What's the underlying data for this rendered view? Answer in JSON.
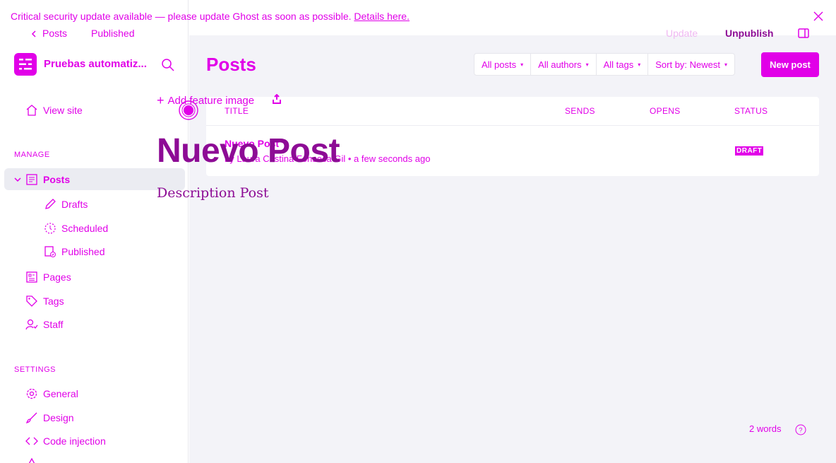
{
  "banner": {
    "text": "Critical security update available — please update Ghost as soon as possible.",
    "link": "Details here."
  },
  "editor_header": {
    "back_label": "Posts",
    "status": "Published",
    "update_label": "Update",
    "unpublish_label": "Unpublish"
  },
  "sidebar": {
    "brand": "Pruebas automatiz...",
    "view_site": "View site",
    "manage_heading": "MANAGE",
    "items": [
      {
        "label": "Posts",
        "icon": "posts-icon"
      },
      {
        "label": "Drafts",
        "icon": "pencil-icon"
      },
      {
        "label": "Scheduled",
        "icon": "clock-icon"
      },
      {
        "label": "Published",
        "icon": "published-icon"
      },
      {
        "label": "Pages",
        "icon": "pages-icon"
      },
      {
        "label": "Tags",
        "icon": "tag-icon"
      },
      {
        "label": "Staff",
        "icon": "staff-icon"
      }
    ],
    "settings_heading": "SETTINGS",
    "settings": [
      {
        "label": "General",
        "icon": "gear-icon"
      },
      {
        "label": "Design",
        "icon": "brush-icon"
      },
      {
        "label": "Code injection",
        "icon": "code-icon"
      }
    ]
  },
  "posts_page": {
    "title": "Posts",
    "filters": [
      "All posts",
      "All authors",
      "All tags",
      "Sort by: Newest"
    ],
    "new_post": "New post",
    "columns": [
      "TITLE",
      "SENDS",
      "OPENS",
      "STATUS"
    ],
    "rows": [
      {
        "title": "Nuevo Post",
        "author": "Laura Cristina Fonseca Gil",
        "time": "a few seconds ago",
        "status": "DRAFT"
      }
    ]
  },
  "editor": {
    "add_feature_image": "Add feature image",
    "post_title": "Nuevo Post",
    "description": "Description Post",
    "word_count": "2 words"
  },
  "colors": {
    "accent": "#e100e8",
    "dark_accent": "#8d0b95",
    "background": "#f3f3f8"
  }
}
